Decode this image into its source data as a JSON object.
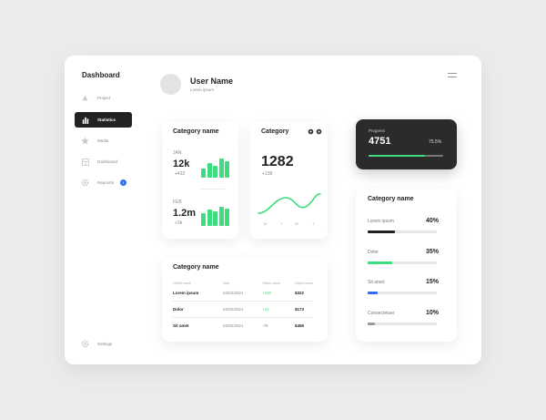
{
  "sidebar": {
    "title": "Dashboard",
    "items": [
      {
        "label": "Project",
        "icon": "triangle-icon"
      },
      {
        "label": "Statistics",
        "icon": "bar-chart-icon",
        "active": true
      },
      {
        "label": "Media",
        "icon": "star-icon"
      },
      {
        "label": "Dashboard",
        "icon": "grid-icon"
      },
      {
        "label": "Reposrts",
        "icon": "gear-icon",
        "badge": "1"
      }
    ],
    "settings_label": "Settings"
  },
  "header": {
    "user_name": "User Name",
    "user_sub": "Lorem ipsum"
  },
  "category_card": {
    "title": "Category name",
    "metrics": [
      {
        "label": "JAN",
        "value": "12k",
        "change": "+432"
      },
      {
        "label": "FEB",
        "value": "1.2m",
        "change": "+3k"
      }
    ]
  },
  "category_line_card": {
    "title": "Category",
    "value": "1282",
    "change": "+138",
    "days": [
      "M",
      "T",
      "W",
      "T"
    ]
  },
  "progress_card": {
    "title": "Progress",
    "value": "4751",
    "percent_label": "75.5%",
    "percent": 75.5
  },
  "progress_list": {
    "title": "Category name",
    "items": [
      {
        "label": "Lorem ipsum",
        "value_label": "40%",
        "value": 40,
        "color": "#222222"
      },
      {
        "label": "Dolor",
        "value_label": "35%",
        "value": 35,
        "color": "#3ddc7e"
      },
      {
        "label": "Sit amet",
        "value_label": "15%",
        "value": 15,
        "color": "#2f6ee8"
      },
      {
        "label": "Consectetuer",
        "value_label": "10%",
        "value": 10,
        "color": "#999999"
      }
    ]
  },
  "table": {
    "title": "Category name",
    "headers": [
      "Object name",
      "Date",
      "Object name",
      "Object name"
    ],
    "rows": [
      {
        "name": "Lorem ipsum",
        "date": "04/02/2021",
        "change": "+432",
        "amount": "$322"
      },
      {
        "name": "Dolor",
        "date": "02/02/2021",
        "change": "+31",
        "amount": "$173"
      },
      {
        "name": "Sit amet",
        "date": "02/02/2021",
        "change": "-75",
        "amount": "$456"
      }
    ]
  },
  "colors": {
    "accent_green": "#3ddc7e",
    "accent_blue": "#2f6ee8",
    "dark": "#2b2b2b"
  }
}
